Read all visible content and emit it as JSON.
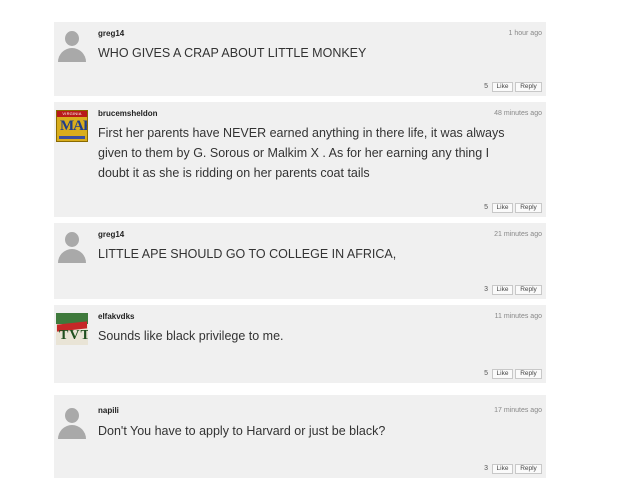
{
  "comments": [
    {
      "username": "greg14",
      "time": "1 hour ago",
      "text": "WHO GIVES A CRAP ABOUT LITTLE MONKEY",
      "likes": "5",
      "like_label": "Like",
      "reply_label": "Reply",
      "avatar": "default-avatar-icon"
    },
    {
      "username": "brucemsheldon",
      "time": "48 minutes ago",
      "text": "First her parents have NEVER earned anything in there life, it was always given to them by G. Sorous or Malkim X . As for her earning any thing I doubt it as she is ridding on her parents coat tails",
      "likes": "5",
      "like_label": "Like",
      "reply_label": "Reply",
      "avatar": "virginia-map-avatar",
      "avatar_text": {
        "top": "VIRGINIA",
        "mark": "MAP"
      }
    },
    {
      "username": "greg14",
      "time": "21 minutes ago",
      "text": "LITTLE APE SHOULD GO TO COLLEGE IN AFRICA,",
      "likes": "3",
      "like_label": "Like",
      "reply_label": "Reply",
      "avatar": "default-avatar-icon"
    },
    {
      "username": "elfakvdks",
      "time": "11 minutes ago",
      "text": "Sounds like black privilege to me.",
      "likes": "5",
      "like_label": "Like",
      "reply_label": "Reply",
      "avatar": "tvt-avatar",
      "avatar_text": {
        "mark": "TVT"
      }
    },
    {
      "username": "napili",
      "time": "17 minutes ago",
      "text": "Don't You have to apply to Harvard or just be black?",
      "likes": "3",
      "like_label": "Like",
      "reply_label": "Reply",
      "avatar": "default-avatar-icon"
    }
  ]
}
